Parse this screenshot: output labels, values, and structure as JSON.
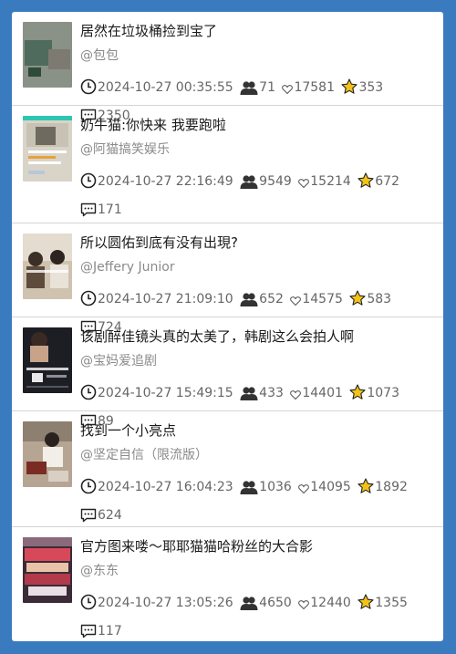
{
  "feed": {
    "items": [
      {
        "title": "居然在垃圾桶捡到宝了",
        "author": "@包包",
        "date": "2024-10-27 00:35:55",
        "views": "71",
        "likes": "17581",
        "favorites": "353",
        "comments": "2350",
        "thumb": {
          "bg": "#8a9186",
          "accent": "#4f6b5d"
        }
      },
      {
        "title": "奶牛猫:你快来 我要跑啦",
        "author": "@阿猫搞笑娱乐",
        "date": "2024-10-27 22:16:49",
        "views": "9549",
        "likes": "15214",
        "favorites": "672",
        "comments": "171",
        "thumb": {
          "bg": "#d9d4c8",
          "accent": "#2cc7b1"
        }
      },
      {
        "title": "所以圆佑到底有没有出現?",
        "author": "@Jeffery Junior",
        "date": "2024-10-27 21:09:10",
        "views": "652",
        "likes": "14575",
        "favorites": "583",
        "comments": "724",
        "thumb": {
          "bg": "#cfc3b0",
          "accent": "#5e4b3c"
        }
      },
      {
        "title": "该剧醉佳镜头真的太美了，韩剧这么会拍人啊",
        "author": "@宝妈爱追剧",
        "date": "2024-10-27 15:49:15",
        "views": "433",
        "likes": "14401",
        "favorites": "1073",
        "comments": "89",
        "thumb": {
          "bg": "#1d1d24",
          "accent": "#c7a38a"
        }
      },
      {
        "title": "找到一个小亮点",
        "author": "@坚定自信（限流版）",
        "date": "2024-10-27 16:04:23",
        "views": "1036",
        "likes": "14095",
        "favorites": "1892",
        "comments": "624",
        "thumb": {
          "bg": "#b7a594",
          "accent": "#7a2b24"
        }
      },
      {
        "title": "官方图来喽～耶耶猫猫哈粉丝的大合影",
        "author": "@东东",
        "date": "2024-10-27 13:05:26",
        "views": "4650",
        "likes": "12440",
        "favorites": "1355",
        "comments": "117",
        "thumb": {
          "bg": "#3b2b38",
          "accent": "#d8485b"
        }
      }
    ]
  },
  "icons": {
    "clock": "clock-icon",
    "views": "people-icon",
    "likes": "heart-icon",
    "favorites": "star-icon",
    "comments": "comment-icon"
  },
  "colors": {
    "background": "#3a7bbf",
    "star": "#f2c21a"
  }
}
